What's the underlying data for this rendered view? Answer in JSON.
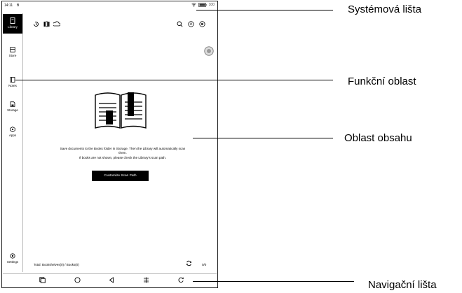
{
  "status_bar": {
    "time": "14:11",
    "indicator": "B",
    "battery": "100"
  },
  "sidebar": {
    "items": [
      {
        "label": "Library",
        "icon": "library-icon"
      },
      {
        "label": "Store",
        "icon": "store-icon"
      },
      {
        "label": "Notes",
        "icon": "notes-icon"
      },
      {
        "label": "Storage",
        "icon": "storage-icon"
      },
      {
        "label": "Apps",
        "icon": "apps-icon"
      }
    ],
    "settings_label": "Settings"
  },
  "toolbar": {
    "left_icons": [
      "history-icon",
      "bookshelf-icon",
      "cloud-icon"
    ],
    "right_icons": [
      "search-icon",
      "sort-icon",
      "menu-icon"
    ]
  },
  "content": {
    "message_line1": "Save documents to the Books folder in Storage. Then the Library will automatically scan",
    "message_line2": "them.",
    "message_line3": "If books are not shown, please check the Library's scan path.",
    "button_label": "Customize Scan Path"
  },
  "footer": {
    "total": "Total: Bookshelves(0) / Books(0)",
    "page": "0/0"
  },
  "navbar": {
    "icons": [
      "recent-apps-icon",
      "home-icon",
      "back-icon",
      "refresh-screen-icon",
      "rotate-icon"
    ]
  },
  "callouts": {
    "system_bar": "Systémová lišta",
    "function_area": "Funkční oblast",
    "content_area": "Oblast obsahu",
    "navigation_bar": "Navigační lišta"
  }
}
